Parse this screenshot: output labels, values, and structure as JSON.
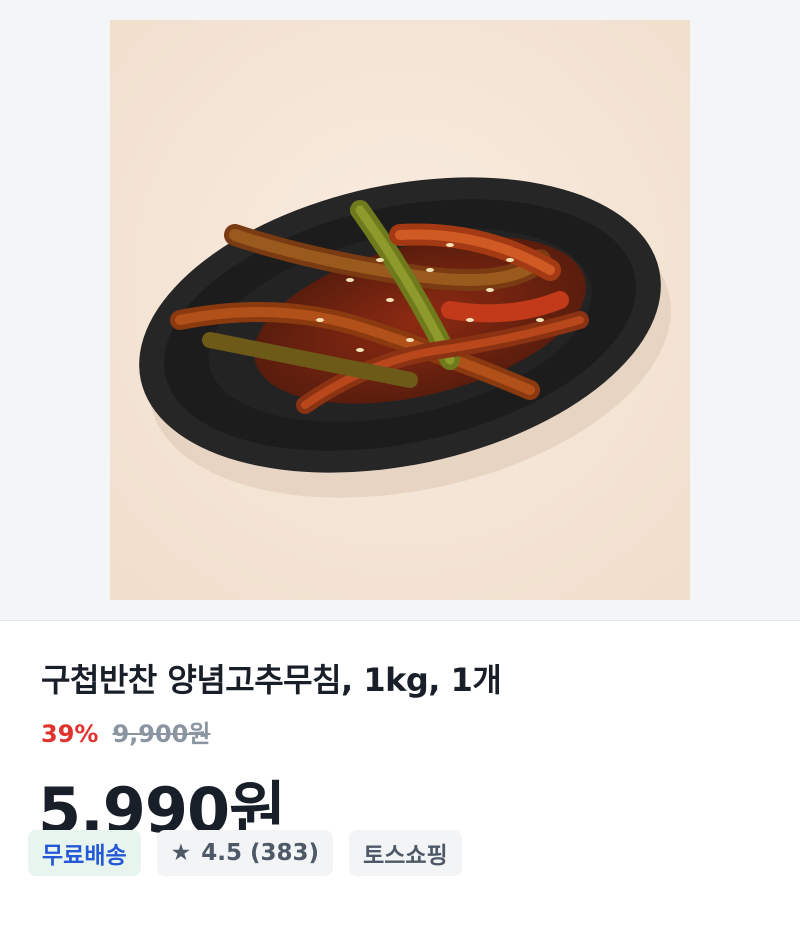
{
  "product": {
    "image_alt": "양념고추무침 반찬 사진",
    "title": "구첩반찬 양념고추무침, 1kg, 1개",
    "discount": "39%",
    "original_price": "9,900원",
    "price": "5,990원"
  },
  "badges": {
    "shipping": "무료배송",
    "rating_icon": "star-icon",
    "rating": "4.5",
    "review_count": "(383)",
    "store": "토스쇼핑"
  },
  "colors": {
    "discount": "#e0332e",
    "shipping_text": "#2558d6",
    "shipping_bg": "#e8f5ef",
    "badge_bg": "#f2f4f6"
  }
}
